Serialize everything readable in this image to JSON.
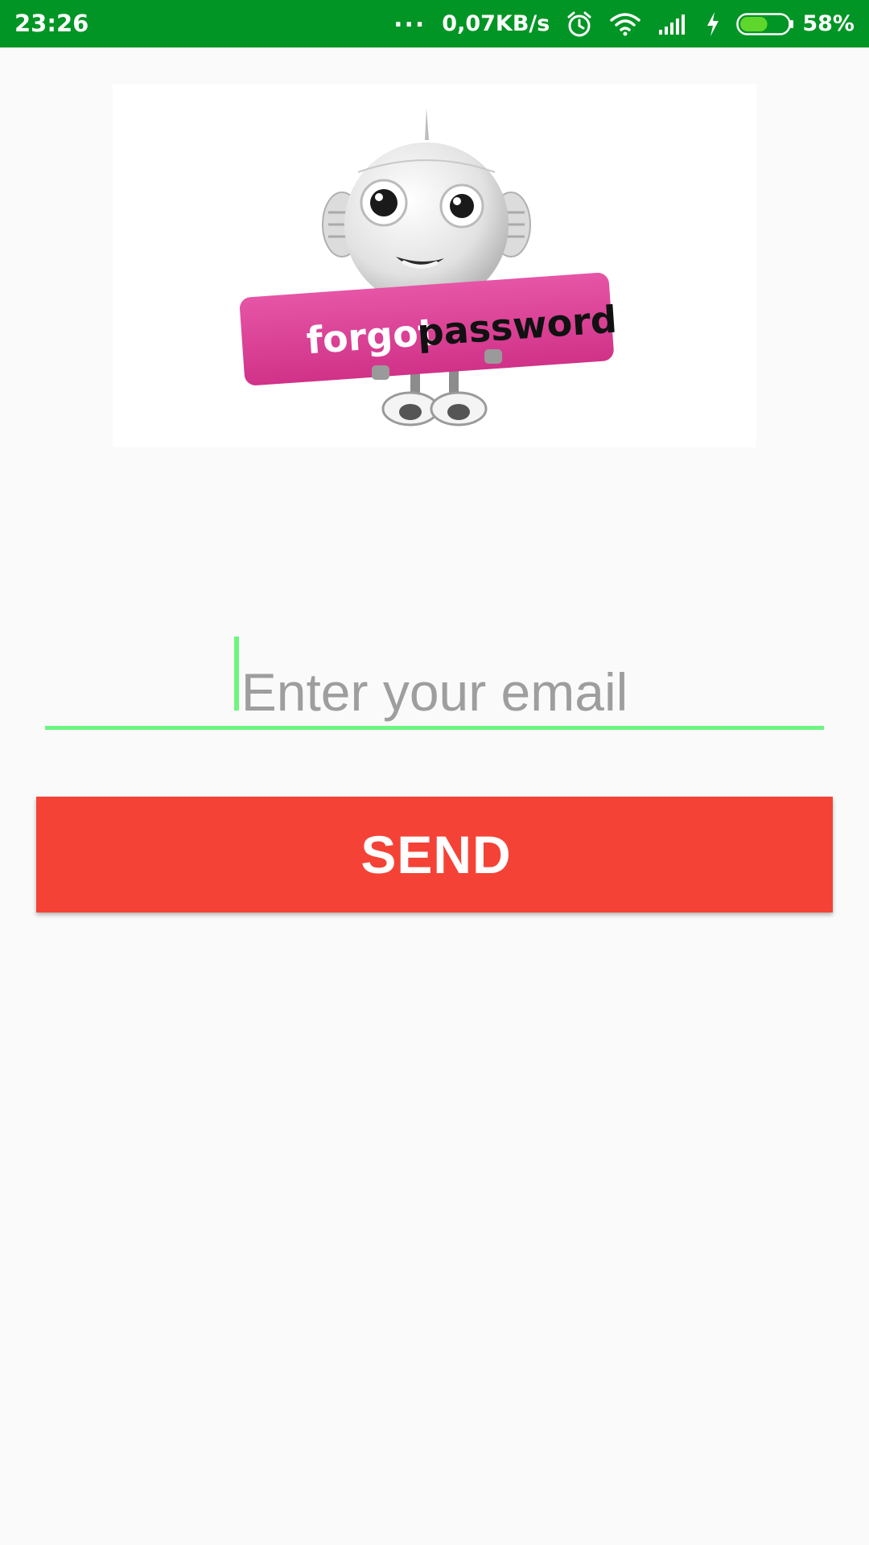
{
  "status_bar": {
    "time": "23:26",
    "dots": "...",
    "net_speed": "0,07KB/s",
    "battery_percent": "58%",
    "battery_level": 0.58,
    "icons": [
      "alarm-icon",
      "wifi-icon",
      "signal-icon",
      "charging-icon",
      "battery-icon"
    ],
    "background_color": "#009524"
  },
  "illustration": {
    "sign_text_white": "forgot",
    "sign_text_black": "password",
    "sign_color": "#df3e98"
  },
  "email_field": {
    "value": "",
    "placeholder": "Enter your email",
    "accent_color": "#6ef57f"
  },
  "send_button": {
    "label": "SEND",
    "color": "#f44336"
  }
}
